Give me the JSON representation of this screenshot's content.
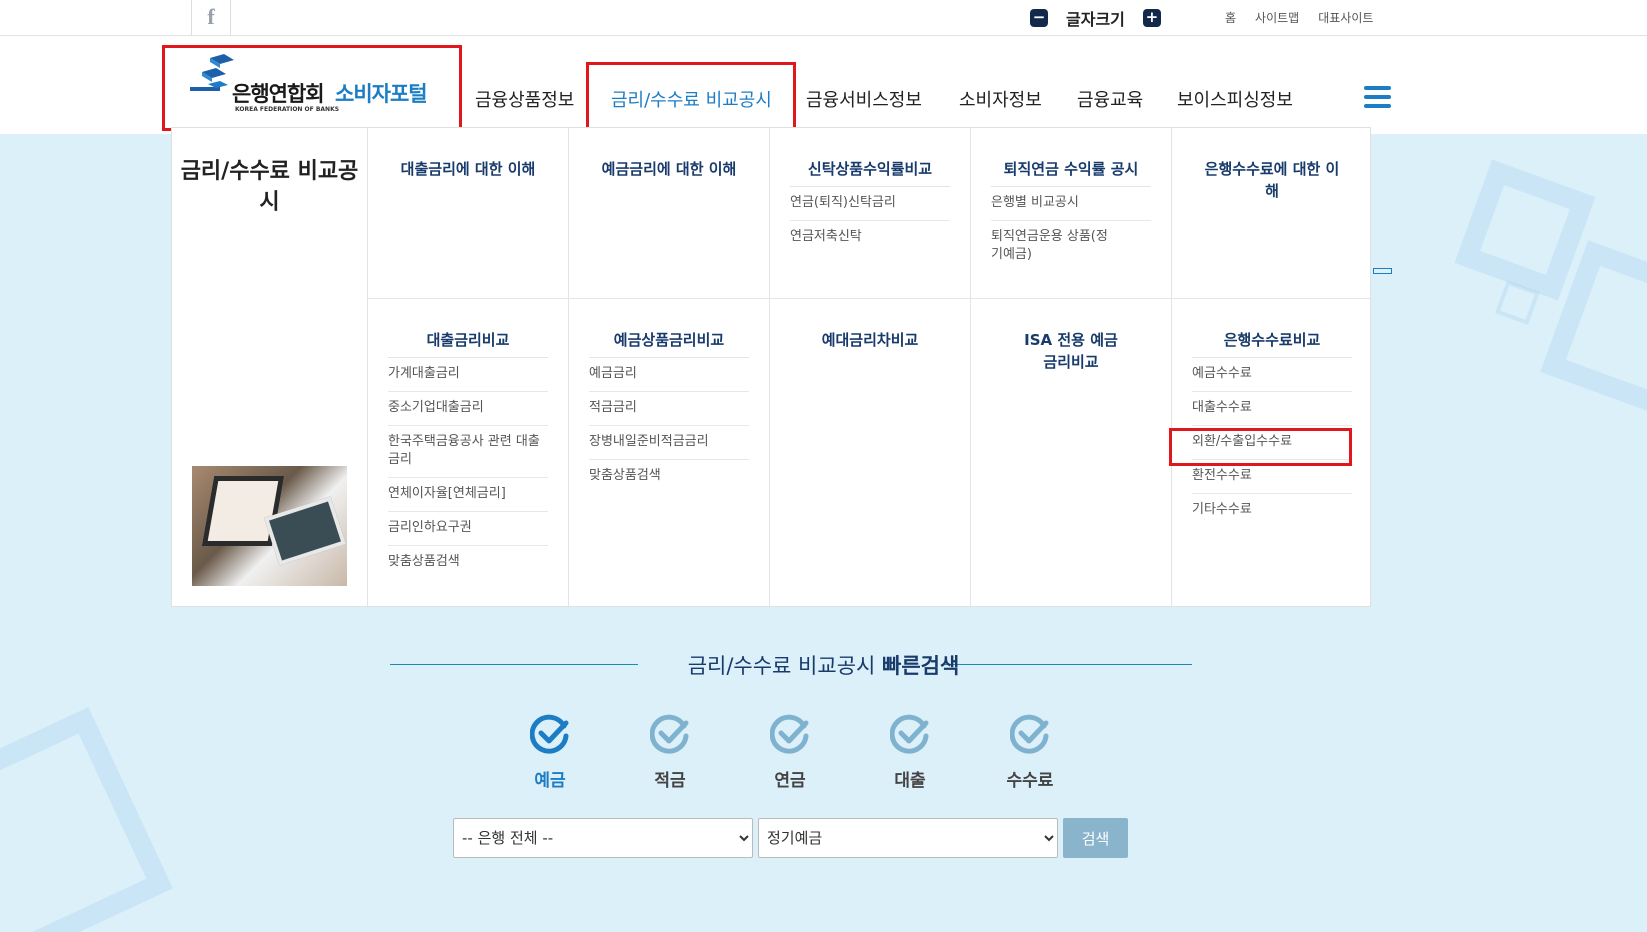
{
  "util": {
    "facebook": "f",
    "fontsize_label": "글자크기",
    "fontsize_minus": "−",
    "fontsize_plus": "+",
    "links": [
      "홈",
      "사이트맵",
      "대표사이트"
    ]
  },
  "logo": {
    "korean": "은행연합회",
    "english": "KOREA FEDERATION OF BANKS",
    "portal": "소비자포털"
  },
  "nav": [
    "금융상품정보",
    "금리/수수료 비교공시",
    "금융서비스정보",
    "소비자정보",
    "금융교육",
    "보이스피싱정보"
  ],
  "mega": {
    "title": "금리/수수료 비교공시",
    "row1": [
      {
        "title": "대출금리에 대한 이해",
        "items": []
      },
      {
        "title": "예금금리에 대한 이해",
        "items": []
      },
      {
        "title": "신탁상품수익률비교",
        "items": [
          "연금(퇴직)신탁금리",
          "연금저축신탁"
        ]
      },
      {
        "title": "퇴직연금 수익률 공시",
        "items": [
          "은행별 비교공시",
          "퇴직연금운용 상품(정기예금)"
        ]
      },
      {
        "title": "은행수수료에 대한 이해",
        "items": []
      }
    ],
    "row2": [
      {
        "title": "대출금리비교",
        "items": [
          "가계대출금리",
          "중소기업대출금리",
          "한국주택금융공사 관련 대출금리",
          "연체이자율[연체금리]",
          "금리인하요구권",
          "맞춤상품검색"
        ]
      },
      {
        "title": "예금상품금리비교",
        "items": [
          "예금금리",
          "적금금리",
          "장병내일준비적금금리",
          "맞춤상품검색"
        ]
      },
      {
        "title": "예대금리차비교",
        "items": []
      },
      {
        "title": "ISA 전용 예금 금리비교",
        "items": []
      },
      {
        "title": "은행수수료비교",
        "items": [
          "예금수수료",
          "대출수수료",
          "외환/수출입수수료",
          "환전수수료",
          "기타수수료"
        ]
      }
    ]
  },
  "quick_search": {
    "title_normal": "금리/수수료 비교공시 ",
    "title_bold": "빠른검색",
    "categories": [
      "예금",
      "적금",
      "연금",
      "대출",
      "수수료"
    ],
    "active_index": 0,
    "bank_select": "-- 은행 전체 --",
    "product_select": "정기예금",
    "search_button": "검색"
  },
  "colors": {
    "accent": "#1d7dc4",
    "navy": "#183b6b",
    "highlight_box": "#e0181d",
    "background": "#dcf0fa"
  }
}
